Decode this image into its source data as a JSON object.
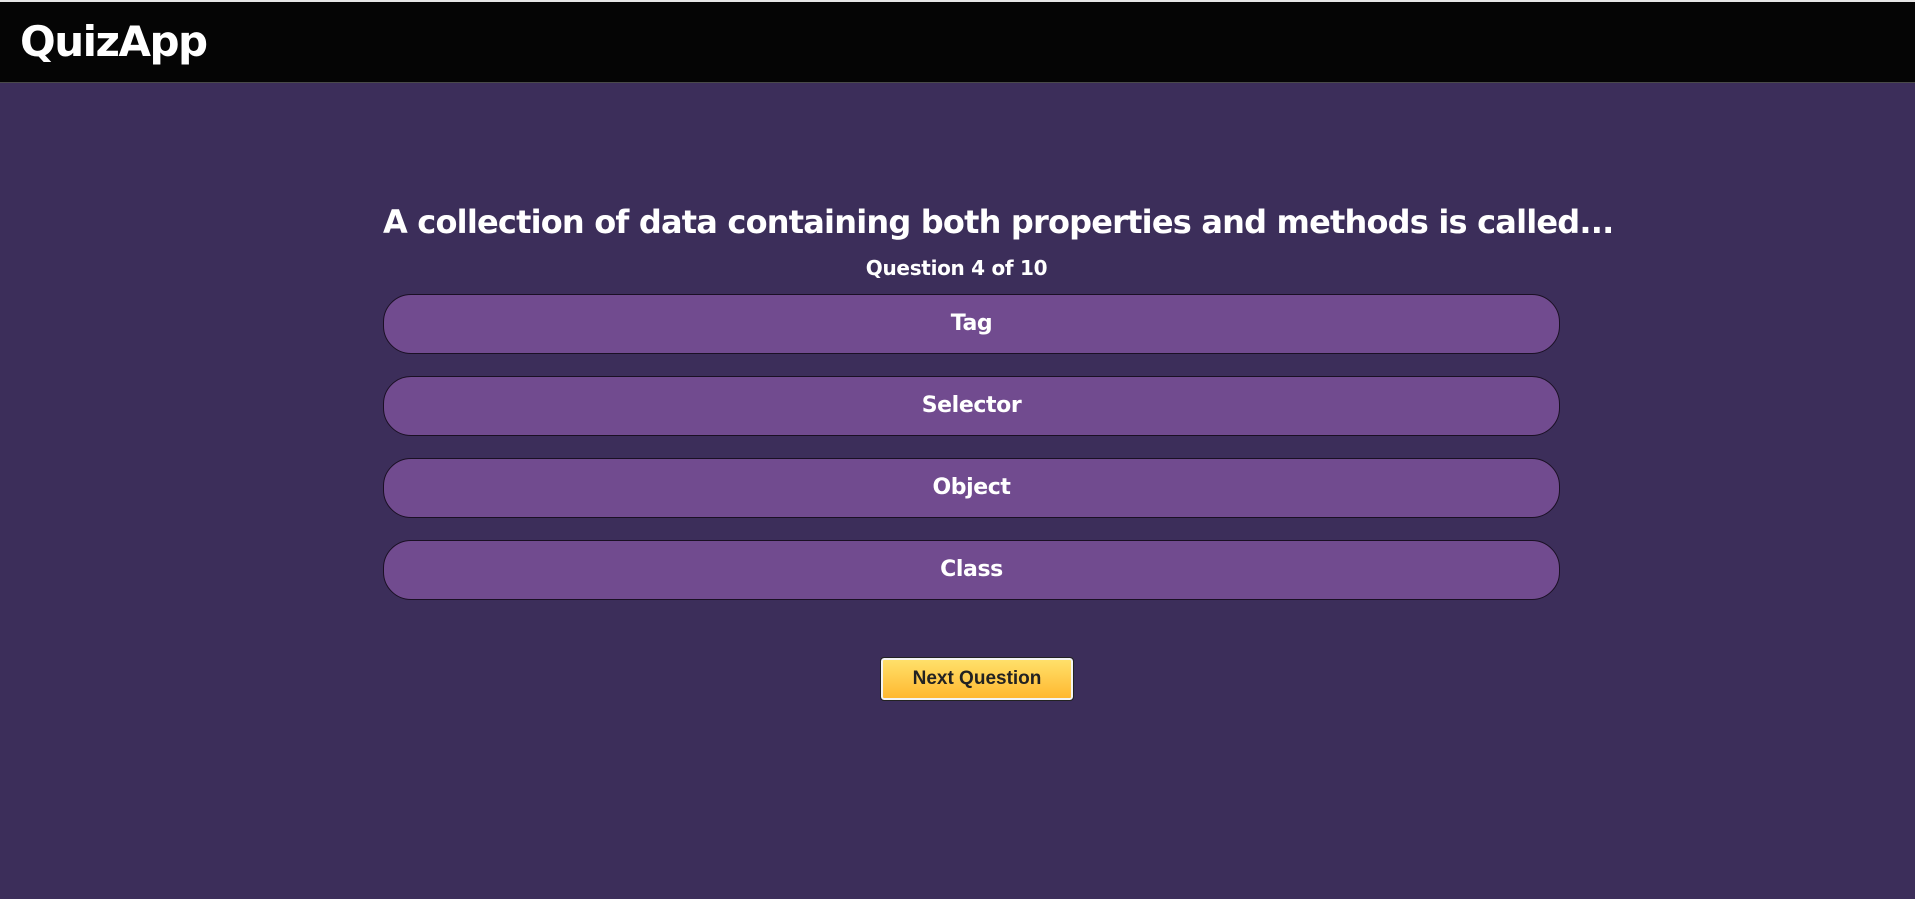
{
  "header": {
    "brand": "QuizApp"
  },
  "quiz": {
    "question": "A collection of data containing both properties and methods is called...",
    "progress": "Question 4 of 10",
    "answers": [
      {
        "label": "Tag"
      },
      {
        "label": "Selector"
      },
      {
        "label": "Object"
      },
      {
        "label": "Class"
      }
    ],
    "next_label": "Next Question"
  },
  "colors": {
    "background": "#3c2e5a",
    "navbar": "#050505",
    "answer": "#714b8f",
    "next_button": "#ffc63f"
  }
}
